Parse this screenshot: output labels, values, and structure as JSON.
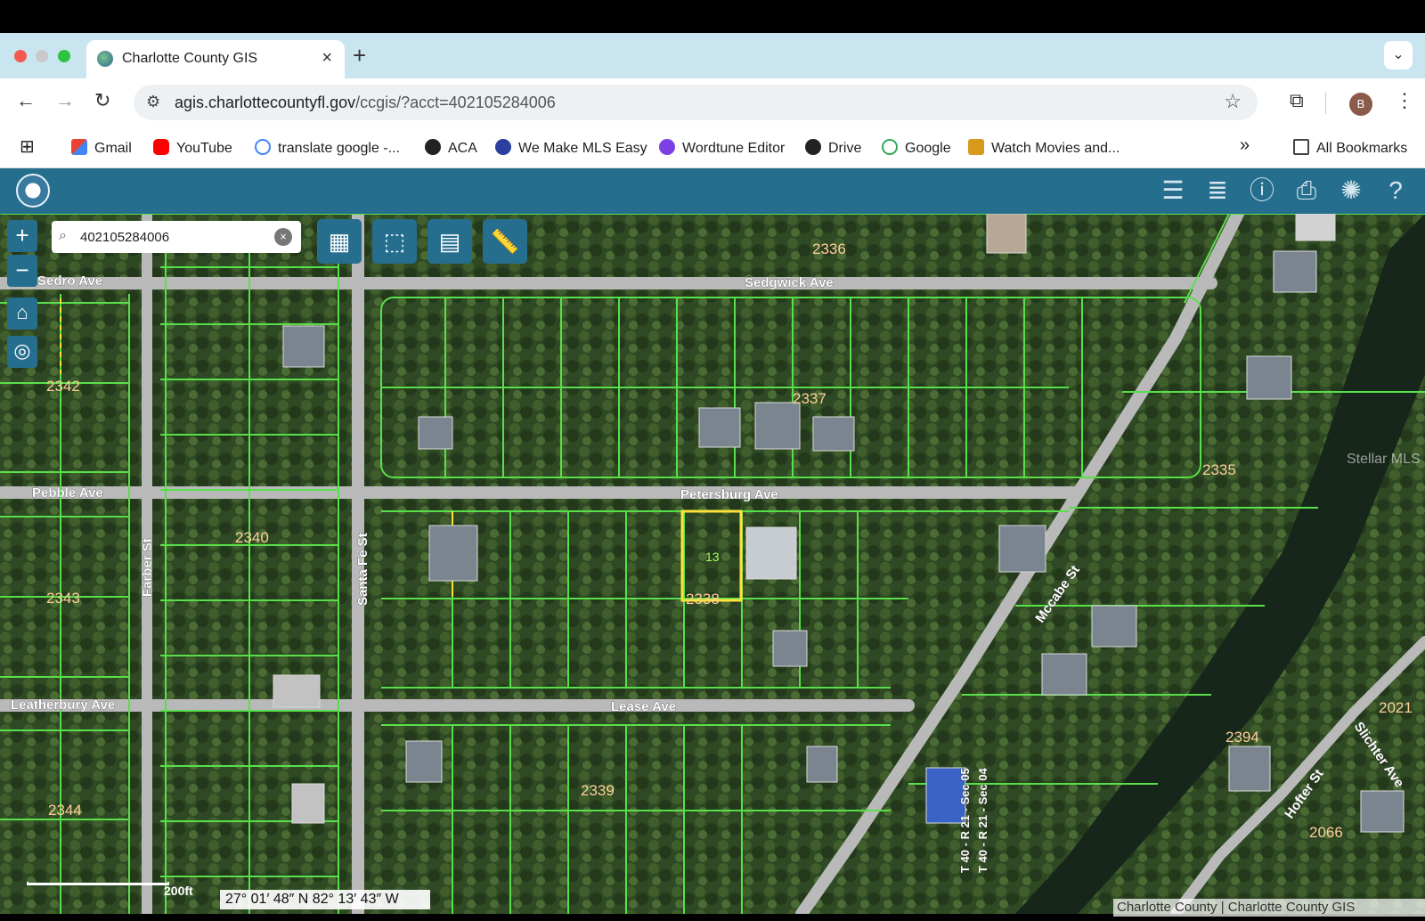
{
  "browser": {
    "tab_title": "Charlotte County GIS",
    "url_domain": "agis.charlottecountyfl.gov",
    "url_path": "/ccgis/?acct=402105284006",
    "avatar_letter": "B",
    "bookmarks": [
      "Gmail",
      "YouTube",
      "translate google -...",
      "ACA",
      "We Make MLS Easy",
      "Wordtune Editor",
      "Drive",
      "Google",
      "Watch Movies and..."
    ],
    "all_bookmarks": "All Bookmarks",
    "overflow": "»"
  },
  "map": {
    "search_value": "402105284006",
    "coordinates": "27° 01′ 48″ N 82° 13′ 43″ W",
    "scale_label": "200ft",
    "attribution": "Charlotte County | Charlotte County GIS",
    "watermark": "Stellar MLS",
    "streets": [
      "Sedgwick Ave",
      "Sedro Ave",
      "Petersburg Ave",
      "Pebble Ave",
      "Lease Ave",
      "Leatherbury Ave",
      "Farber St",
      "Santa Fe St",
      "Mccabe St",
      "Hofter St",
      "Slichter Ave"
    ],
    "blocks": [
      "2336",
      "2337",
      "2342",
      "2340",
      "2343",
      "2344",
      "2338",
      "2339",
      "2335",
      "2394",
      "2066",
      "2021"
    ],
    "selected_lot": "13",
    "section_label": "T 40 - R 21 - Sec 05",
    "section_label_2": "T 40 - R 21 - Sec 04"
  },
  "colors": {
    "app_bar": "#266e8e",
    "parcel_line": "#58e04a",
    "selected_parcel": "#ffe23a",
    "lot_label": "#a6ff60",
    "block_label": "#ffcf9a"
  },
  "icons": {
    "app_toolbar": [
      "layers-icon",
      "legend-list-icon",
      "info-icon",
      "print-icon",
      "brain-icon",
      "help-icon"
    ],
    "map_tools": [
      "grid-select-icon",
      "box-select-icon",
      "report-icon",
      "measure-ruler-icon"
    ]
  }
}
